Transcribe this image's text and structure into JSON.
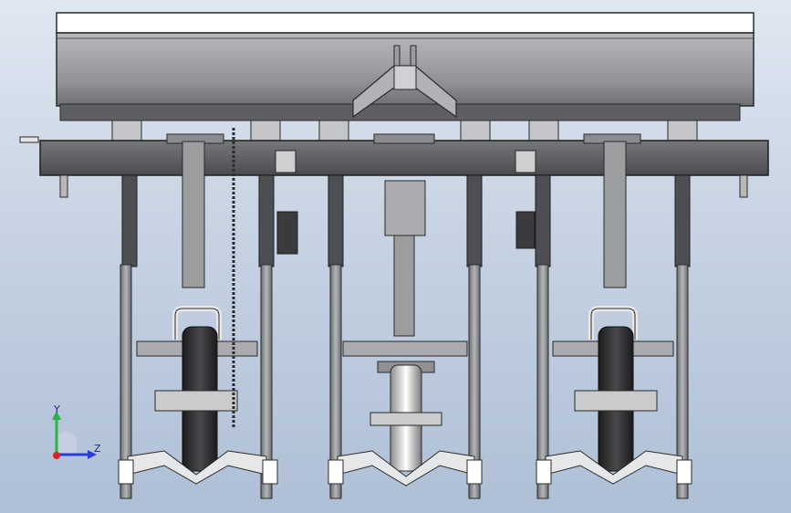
{
  "viewport": {
    "background_top": "#dfe7f1",
    "background_bottom": "#aebfd6"
  },
  "model": {
    "description_icon": "seed-drill-planter-assembly",
    "row_units": 3,
    "metal_color": "#8d8f92",
    "dark_metal_color": "#4a4c4f",
    "frame_color": "#5a5b5d",
    "wheel_color": "#2c2c2e",
    "hopper_color": "#9a9c9f"
  },
  "triad": {
    "y_label": "Y",
    "z_label": "Z",
    "y_color": "#2bb24c",
    "z_color": "#2b3bd8",
    "x_color": "#d42424"
  }
}
